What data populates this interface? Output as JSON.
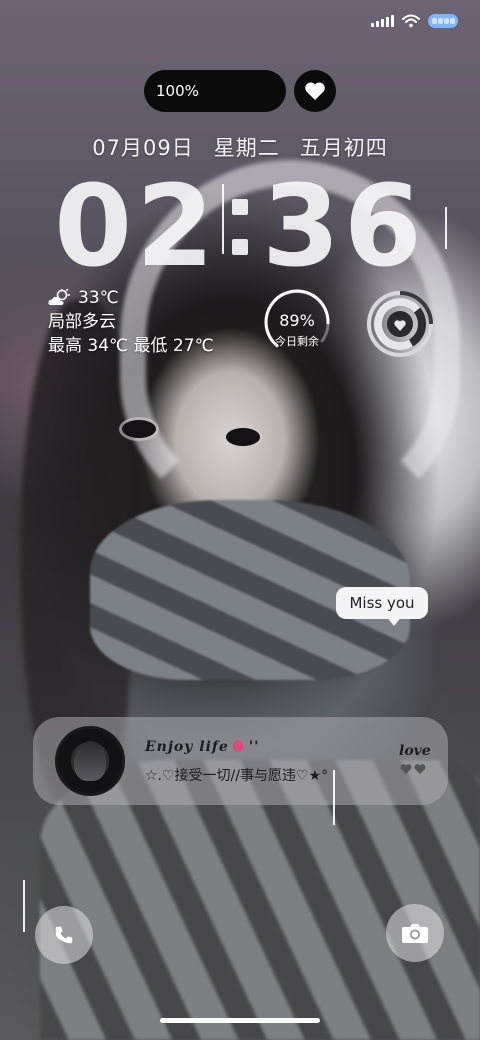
{
  "status_bar": {
    "signal_icon": "signal-icon",
    "wifi_icon": "wifi-icon",
    "battery_icon": "battery-icon"
  },
  "capsule": {
    "text": "100%",
    "heart_icon": "heart-icon"
  },
  "date_line": {
    "date": "07月09日",
    "weekday": "星期二",
    "lunar": "五月初四"
  },
  "clock": {
    "hours": "02",
    "minutes": "36"
  },
  "weather": {
    "icon": "partly-cloudy-icon",
    "temp": "33℃",
    "condition": "局部多云",
    "high_low": "最高 34℃ 最低 27℃"
  },
  "battery_ring": {
    "percent_text": "89%",
    "label": "今日剩余",
    "level": 0.89
  },
  "heart_ring": {
    "icon": "heart-ring-icon"
  },
  "bubble": {
    "text": "Miss you"
  },
  "music_card": {
    "title": "Enjoy life",
    "title_suffix": "''",
    "subtitle": "☆.♡接受一切//事与愿违♡★°",
    "love": "love",
    "hearts": "🖤🖤"
  },
  "shortcuts": {
    "phone_icon": "phone-icon",
    "camera_icon": "camera-icon"
  },
  "colors": {
    "capsule_bg": "#0b0b0c",
    "battery_pill": "#7fb4ff",
    "bubble_bg": "#f4f4f6"
  }
}
